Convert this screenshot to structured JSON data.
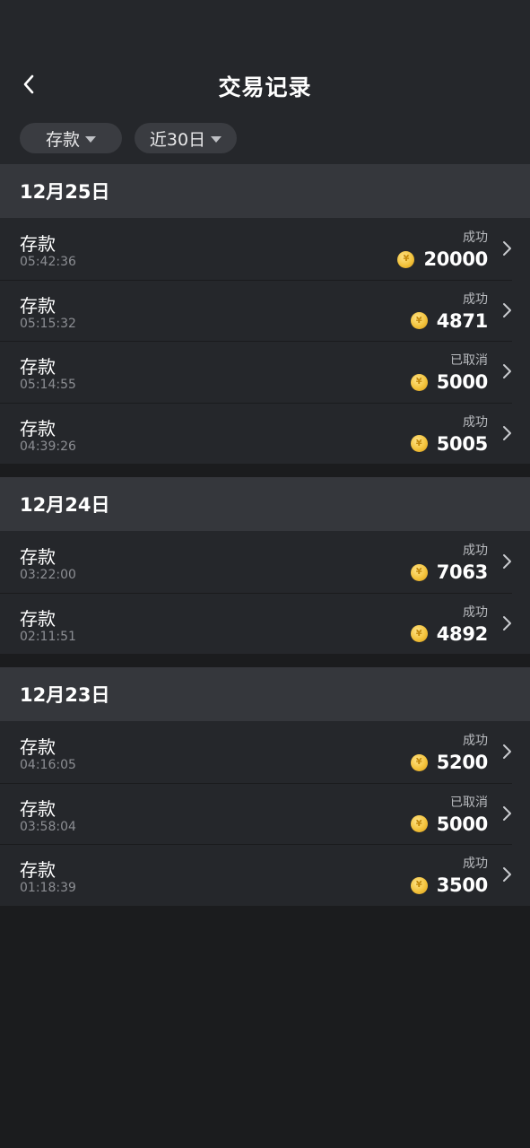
{
  "header": {
    "title": "交易记录",
    "back_icon": "chevron-left-icon",
    "filters": [
      {
        "label": "存款",
        "icon": "caret-down-icon"
      },
      {
        "label": "近30日",
        "icon": "caret-down-icon"
      }
    ]
  },
  "colors": {
    "background": "#1b1c1e",
    "header_bg": "#25272b",
    "date_header_bg": "#35373c",
    "row_bg": "#25272b",
    "coin": "#f3c33c"
  },
  "groups": [
    {
      "date": "12月25日",
      "rows": [
        {
          "type": "存款",
          "time": "05:42:36",
          "status": "成功",
          "amount": "20000",
          "coin_symbol": "¥"
        },
        {
          "type": "存款",
          "time": "05:15:32",
          "status": "成功",
          "amount": "4871",
          "coin_symbol": "¥"
        },
        {
          "type": "存款",
          "time": "05:14:55",
          "status": "已取消",
          "amount": "5000",
          "coin_symbol": "¥"
        },
        {
          "type": "存款",
          "time": "04:39:26",
          "status": "成功",
          "amount": "5005",
          "coin_symbol": "¥"
        }
      ]
    },
    {
      "date": "12月24日",
      "rows": [
        {
          "type": "存款",
          "time": "03:22:00",
          "status": "成功",
          "amount": "7063",
          "coin_symbol": "¥"
        },
        {
          "type": "存款",
          "time": "02:11:51",
          "status": "成功",
          "amount": "4892",
          "coin_symbol": "¥"
        }
      ]
    },
    {
      "date": "12月23日",
      "rows": [
        {
          "type": "存款",
          "time": "04:16:05",
          "status": "成功",
          "amount": "5200",
          "coin_symbol": "¥"
        },
        {
          "type": "存款",
          "time": "03:58:04",
          "status": "已取消",
          "amount": "5000",
          "coin_symbol": "¥"
        },
        {
          "type": "存款",
          "time": "01:18:39",
          "status": "成功",
          "amount": "3500",
          "coin_symbol": "¥"
        }
      ]
    }
  ]
}
